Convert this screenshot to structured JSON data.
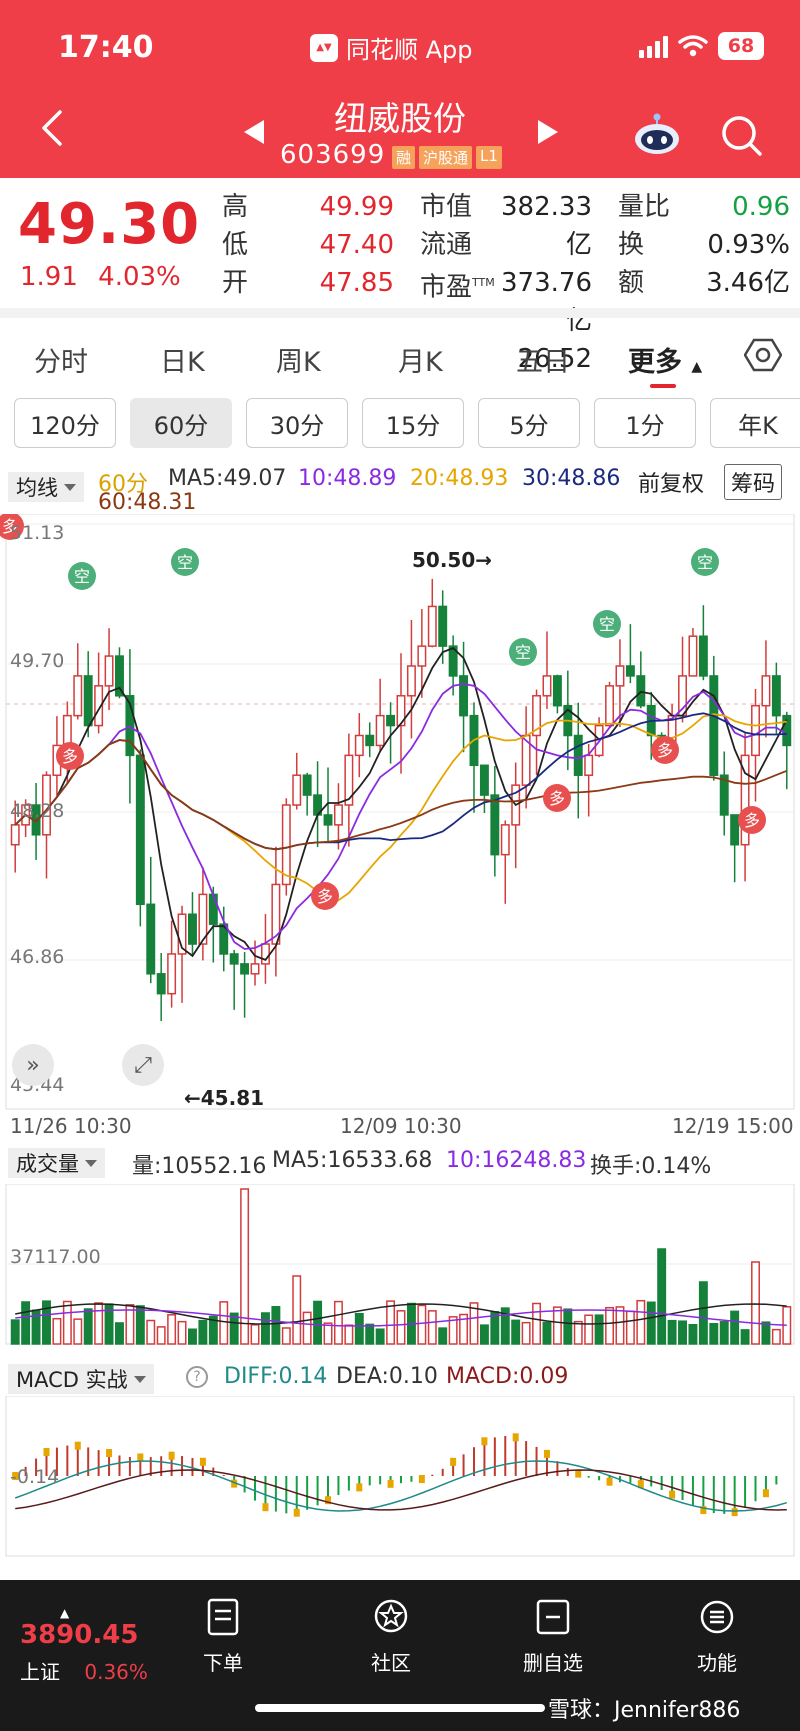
{
  "status": {
    "time": "17:40",
    "app_name": "同花顺 App",
    "battery": "68"
  },
  "header": {
    "stock_name": "纽威股份",
    "stock_code": "603699",
    "tags": [
      "融",
      "沪股通",
      "L1"
    ]
  },
  "quote": {
    "price": "49.30",
    "change": "1.91",
    "change_pct": "4.03%",
    "rows": [
      {
        "l1": "高",
        "v1": "49.99",
        "l2": "市值",
        "v2": "382.33亿",
        "l3": "量比",
        "v3": "0.96"
      },
      {
        "l1": "低",
        "v1": "47.40",
        "l2": "流通",
        "v2": "373.76亿",
        "l3": "换",
        "v3": "0.93%"
      },
      {
        "l1": "开",
        "v1": "47.85",
        "l2": "市盈",
        "l2sup": "TTM",
        "v2": "26.52",
        "l3": "额",
        "v3": "3.46亿"
      }
    ]
  },
  "tabs": [
    "分时",
    "日K",
    "周K",
    "月K",
    "五日",
    "更多"
  ],
  "periods": [
    "120分",
    "60分",
    "30分",
    "15分",
    "5分",
    "1分",
    "年K"
  ],
  "ma": {
    "selector": "均线",
    "period": "60分",
    "ma5": "MA5:49.07",
    "ma10": "10:48.89",
    "ma20": "20:48.93",
    "ma30": "30:48.86",
    "ma60": "60:48.31",
    "fuquan": "前复权",
    "chouma": "筹码"
  },
  "price_chart": {
    "y_labels": [
      "51.13",
      "49.70",
      "48.28",
      "46.86",
      "45.44"
    ],
    "x_labels": [
      "11/26 10:30",
      "12/09 10:30",
      "12/19 15:00"
    ],
    "high_annotation": "50.50→",
    "low_annotation": "←45.81",
    "signals": {
      "short": "空",
      "long": "多"
    }
  },
  "volume": {
    "selector": "成交量",
    "vol": "量:10552.16",
    "ma5": "MA5:16533.68",
    "ma10": "10:16248.83",
    "turnover": "换手:0.14%",
    "y_label": "37117.00"
  },
  "macd": {
    "selector": "MACD 实战",
    "diff": "DIFF:0.14",
    "dea": "DEA:0.10",
    "macd": "MACD:0.09",
    "y_label": "-0.14"
  },
  "bottom": {
    "index_value": "3890.45",
    "index_name": "上证",
    "index_pct": "0.36%",
    "nav": [
      "下单",
      "社区",
      "删自选",
      "功能"
    ],
    "watermark": "雪球：Jennifer886"
  },
  "colors": {
    "accent": "#ef3e47",
    "up": "#e1262d",
    "down": "#15a043"
  }
}
